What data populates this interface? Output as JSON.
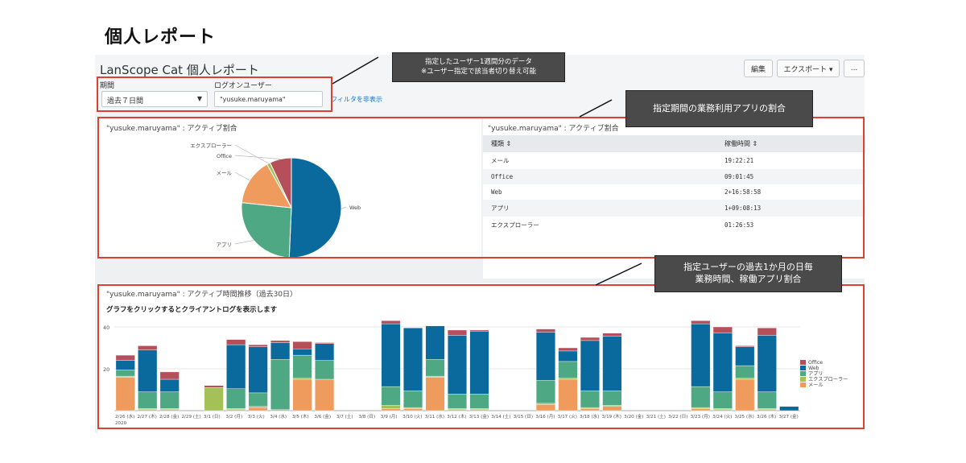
{
  "page_title": "個人レポート",
  "header": {
    "app_title": "LanScope Cat 個人レポート",
    "edit_label": "編集",
    "export_label": "エクスポート ▾",
    "more_label": "..."
  },
  "filters": {
    "period_label": "期間",
    "period_value": "過去７日間",
    "user_label": "ログオンユーザー",
    "user_value": "\"yusuke.maruyama\"",
    "hide_filter_link": "フィルタを非表示"
  },
  "callouts": {
    "top": [
      "指定したユーザー1週間分のデータ",
      "※ユーザー指定で該当者切り替え可能"
    ],
    "right": [
      "指定期間の業務利用アプリの割合"
    ],
    "bottom": [
      "指定ユーザーの過去1か月の日毎",
      "業務時間、稼働アプリ割合"
    ]
  },
  "pie_panel": {
    "title": "\"yusuke.maruyama\" : アクティブ割合"
  },
  "table_panel": {
    "title": "\"yusuke.maruyama\" : アクティブ割合",
    "columns": [
      "種類 ⇕",
      "稼働時間 ⇕"
    ],
    "rows": [
      [
        "メール",
        "19:22:21"
      ],
      [
        "Office",
        "09:01:45"
      ],
      [
        "Web",
        "2+16:58:58"
      ],
      [
        "アプリ",
        "1+09:08:13"
      ],
      [
        "エクスプローラー",
        "01:26:53"
      ]
    ]
  },
  "bar_panel": {
    "title": "\"yusuke.maruyama\" : アクティブ時間推移（過去30日）",
    "subtitle": "グラフをクリックするとクライアントログを表示します"
  },
  "colors": {
    "office": "#b54f5a",
    "web": "#0a6a9d",
    "app": "#4fa884",
    "explorer": "#a3c157",
    "mail": "#ef9b5e",
    "highlight": "#e04030"
  },
  "chart_data": [
    {
      "type": "pie",
      "categories": [
        "Web",
        "アプリ",
        "メール",
        "エクスプローラー",
        "Office"
      ],
      "values": [
        64.7,
        33.1,
        19.4,
        1.4,
        9.0
      ],
      "labels": [
        "Web",
        "アプリ",
        "メール",
        "エクスプローラー",
        "Office"
      ]
    },
    {
      "type": "bar",
      "stacked": true,
      "ylim": [
        0,
        40
      ],
      "yticks": [
        "40",
        "20"
      ],
      "categories": [
        "2/26 (水)",
        "2/27 (木)",
        "2/28 (金)",
        "2/29 (土)",
        "3/1 (日)",
        "3/2 (月)",
        "3/3 (火)",
        "3/4 (水)",
        "3/5 (木)",
        "3/6 (金)",
        "3/7 (土)",
        "3/8 (日)",
        "3/9 (月)",
        "3/10 (火)",
        "3/11 (水)",
        "3/12 (木)",
        "3/13 (金)",
        "3/14 (土)",
        "3/15 (日)",
        "3/16 (月)",
        "3/17 (火)",
        "3/18 (水)",
        "3/19 (木)",
        "3/20 (金)",
        "3/21 (土)",
        "3/22 (日)",
        "3/23 (月)",
        "3/24 (火)",
        "3/25 (水)",
        "3/26 (木)",
        "3/27 (金)"
      ],
      "x_extra_label": "2020",
      "legend": [
        "Office",
        "Web",
        "アプリ",
        "エクスプローラー",
        "メール"
      ],
      "series": [
        {
          "name": "メール",
          "values": [
            16,
            0.5,
            0.5,
            0,
            0,
            0.5,
            1.5,
            0.5,
            15,
            15,
            0,
            0,
            1,
            1,
            16,
            0.5,
            0.5,
            0,
            0,
            3,
            15,
            1,
            2,
            0,
            0,
            0,
            1,
            0.5,
            15,
            0.5,
            0
          ]
        },
        {
          "name": "エクスプローラー",
          "values": [
            0.5,
            0.5,
            0.5,
            0,
            11,
            0.5,
            0.5,
            0,
            0.5,
            0,
            0,
            0,
            1.5,
            0.5,
            0.5,
            0.5,
            0.5,
            0,
            0,
            0.5,
            0.5,
            0.5,
            0.5,
            0,
            0,
            0,
            0.5,
            0.5,
            0.5,
            0.5,
            0
          ]
        },
        {
          "name": "アプリ",
          "values": [
            3,
            8,
            8,
            0,
            0,
            9.5,
            6.5,
            24,
            11,
            9,
            0,
            0,
            9,
            8,
            8,
            7,
            7,
            0,
            0,
            11,
            8,
            8,
            7,
            0,
            0,
            0,
            10,
            8,
            6,
            8,
            0
          ]
        },
        {
          "name": "Web",
          "values": [
            4.5,
            20,
            6,
            0,
            0,
            21,
            22,
            8,
            3,
            8,
            0,
            0,
            30,
            30,
            16,
            28,
            30,
            0,
            0,
            23,
            5,
            24,
            26,
            0,
            0,
            0,
            30,
            28,
            9,
            27,
            2
          ]
        },
        {
          "name": "Office",
          "values": [
            2.5,
            2,
            3.5,
            0,
            1,
            2.5,
            1,
            1,
            3.5,
            0.5,
            0,
            0,
            1.5,
            0,
            0,
            2.5,
            0.5,
            0,
            0,
            1.5,
            1.5,
            1.5,
            1.5,
            0,
            0,
            0,
            1.5,
            3,
            0.5,
            3.5,
            0
          ]
        }
      ]
    }
  ]
}
